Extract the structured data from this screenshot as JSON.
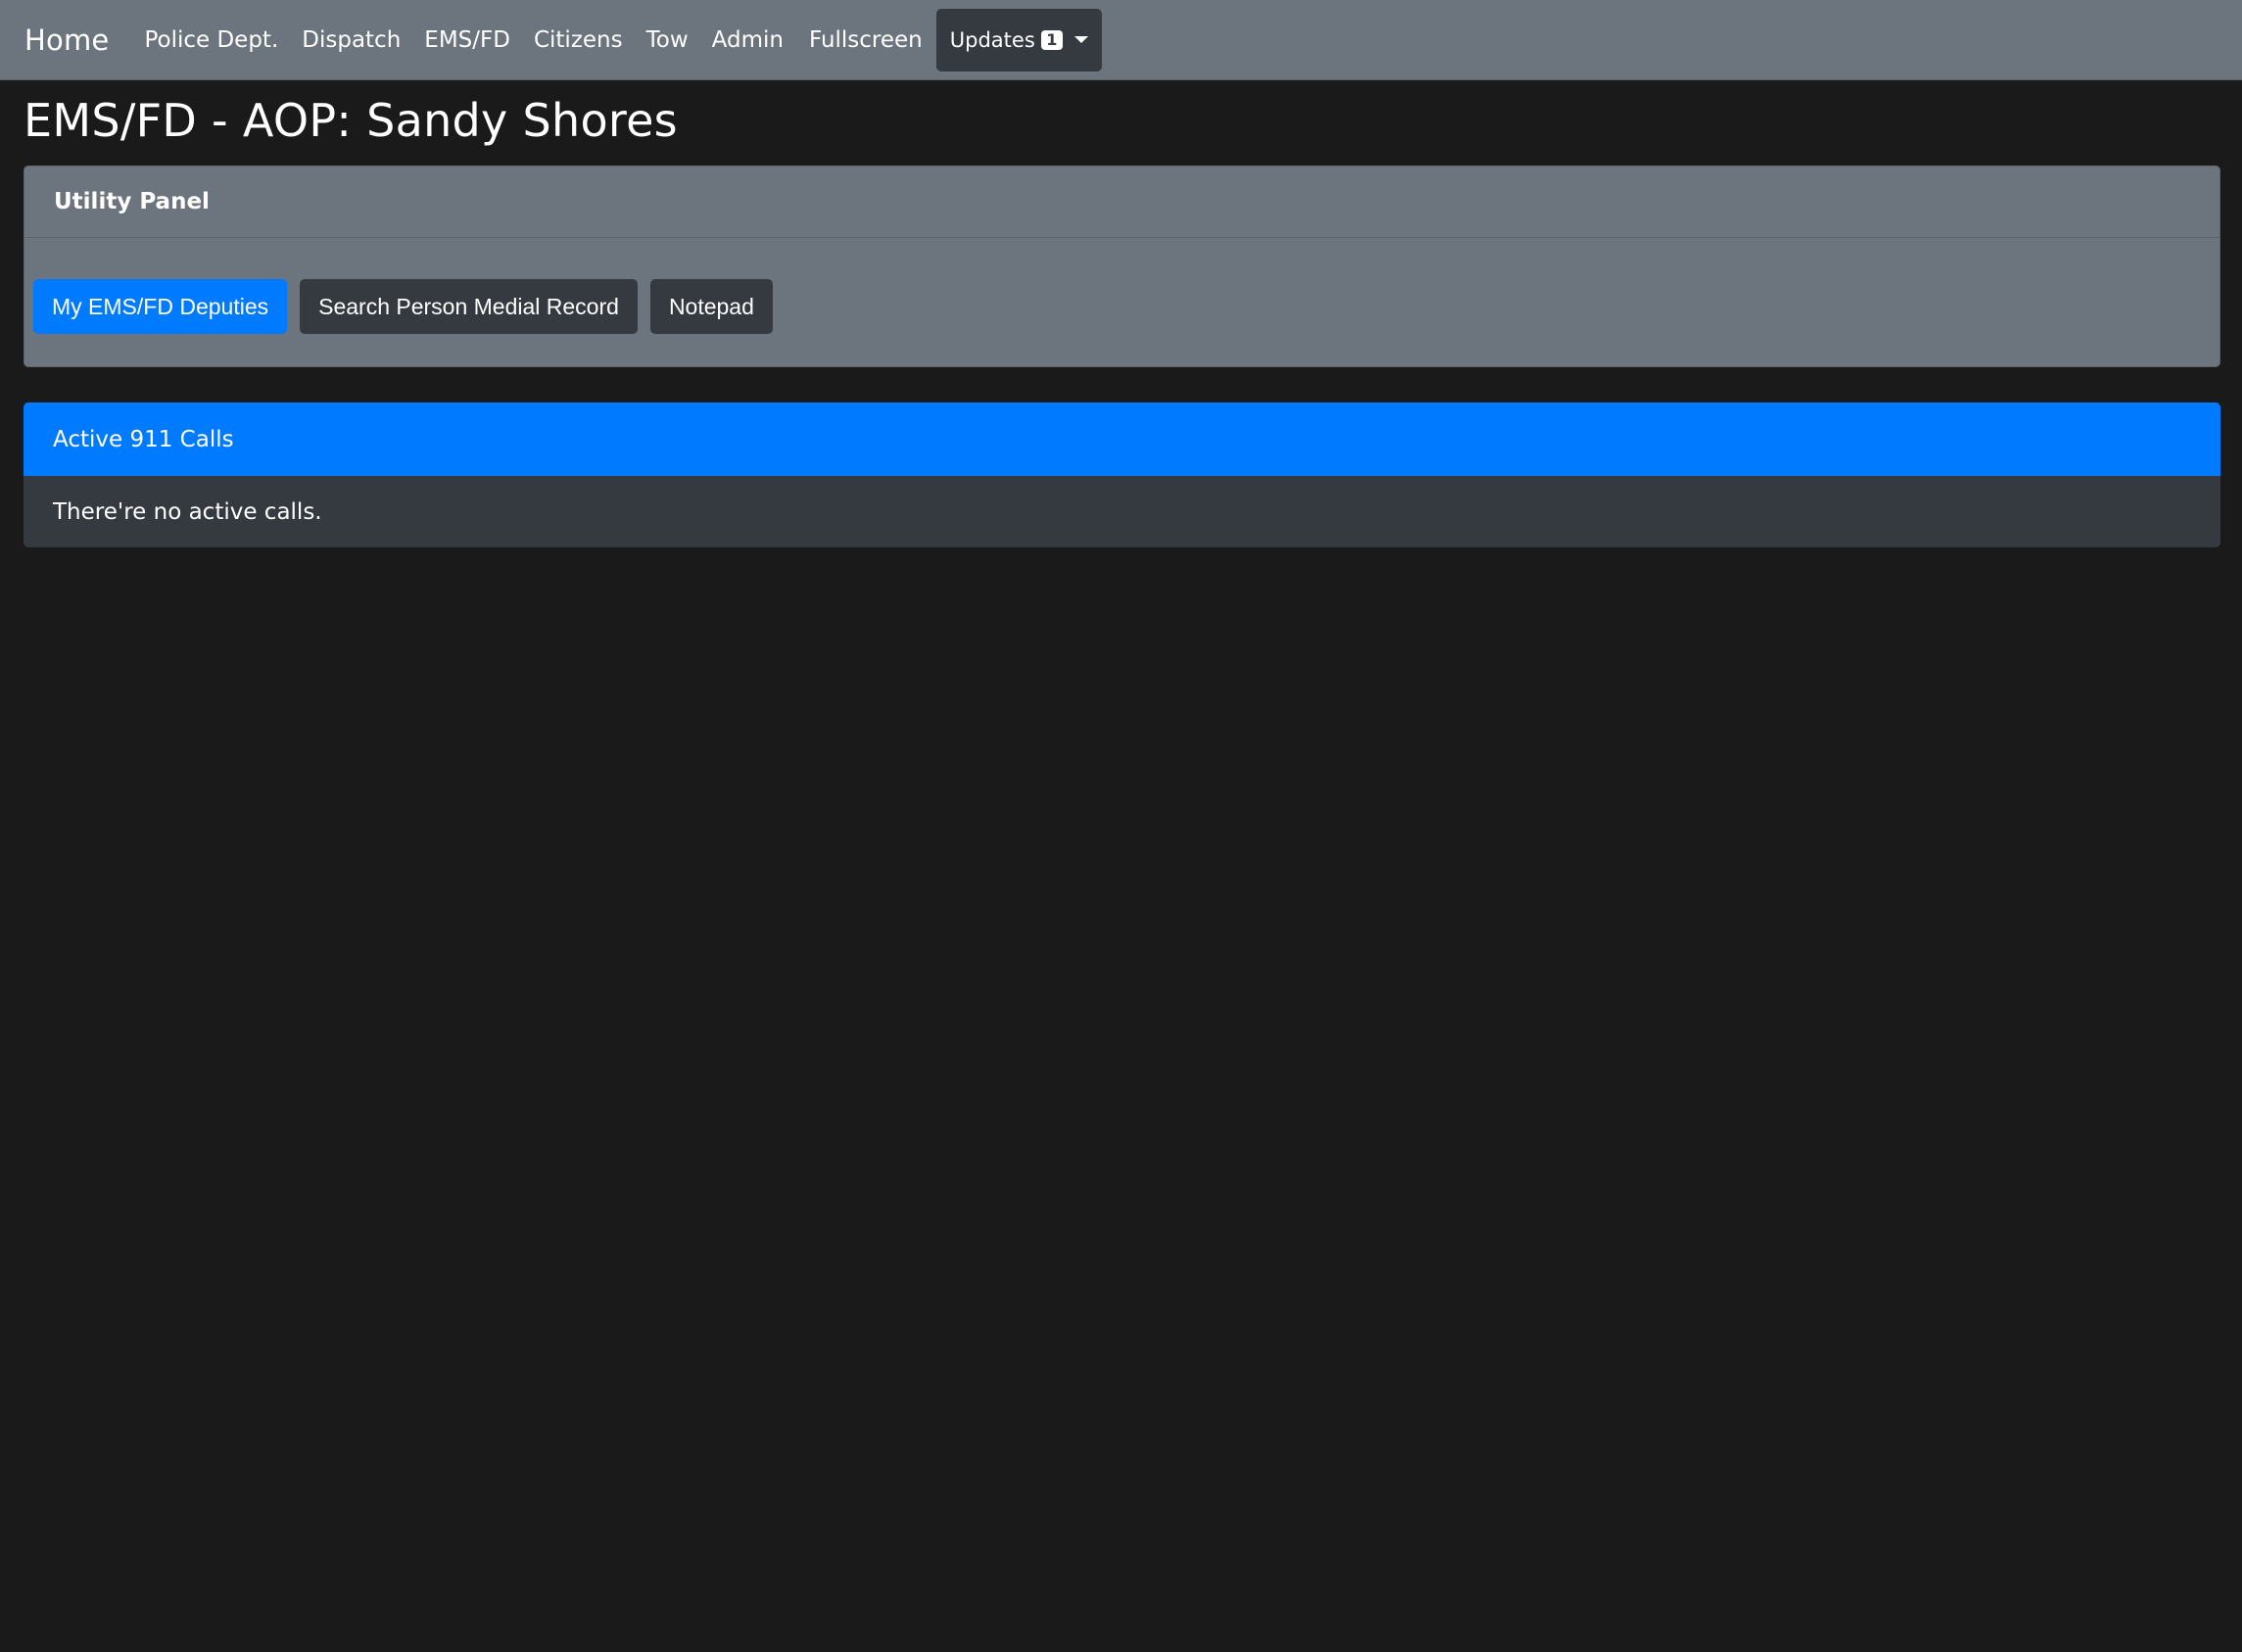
{
  "navbar": {
    "brand": "Home",
    "links": [
      "Police Dept.",
      "Dispatch",
      "EMS/FD",
      "Citizens",
      "Tow",
      "Admin"
    ],
    "fullscreen": "Fullscreen",
    "updates": {
      "label": "Updates",
      "count": "1"
    }
  },
  "page": {
    "title": "EMS/FD - AOP: Sandy Shores"
  },
  "utility_panel": {
    "title": "Utility Panel",
    "buttons": [
      "My EMS/FD Deputies",
      "Search Person Medial Record",
      "Notepad"
    ]
  },
  "active_calls": {
    "title": "Active 911 Calls",
    "empty_message": "There're no active calls."
  },
  "colors": {
    "primary": "#007bff",
    "navbar_bg": "#6c757d",
    "dark_btn": "#343a40",
    "page_bg": "#1a1a1b"
  }
}
